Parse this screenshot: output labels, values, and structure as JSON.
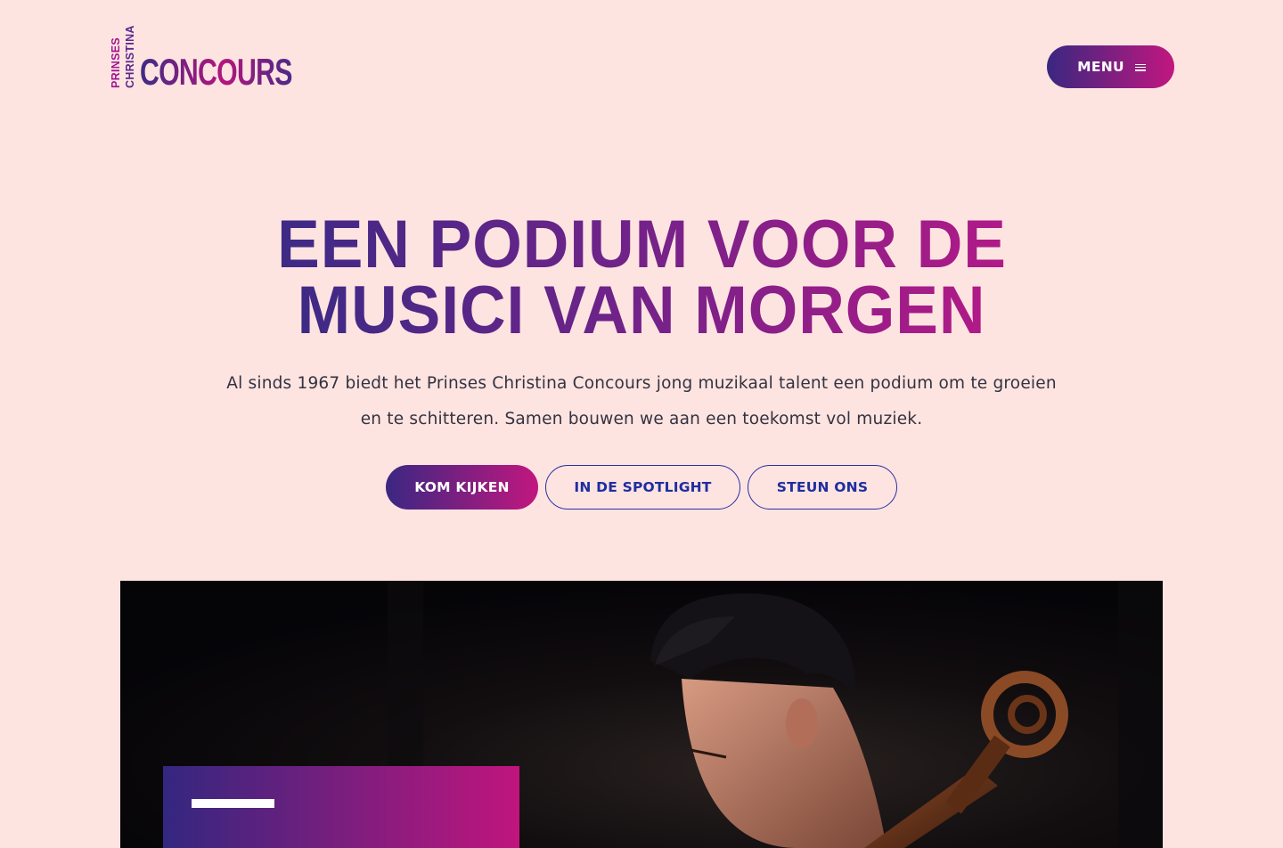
{
  "header": {
    "logo": {
      "line1": "PRINSES",
      "line2": "CHRISTINA",
      "wordmark": "CONCOURS"
    },
    "menu_label": "MENU",
    "menu_icon": "hamburger-icon"
  },
  "hero": {
    "title_line1": "EEN PODIUM VOOR DE",
    "title_line2": "MUSICI VAN MORGEN",
    "intro": "Al sinds 1967 biedt het Prinses Christina Concours jong muzikaal talent een podium om te groeien en te schitteren. Samen bouwen we aan een toekomst vol muziek.",
    "buttons": {
      "primary": "KOM KIJKEN",
      "spotlight": "IN DE SPOTLIGHT",
      "support": "STEUN ONS"
    }
  },
  "colors": {
    "background": "#fde4e1",
    "gradient_start": "#3a2781",
    "gradient_end": "#c1177f",
    "outline_text": "#1f2e9e"
  }
}
